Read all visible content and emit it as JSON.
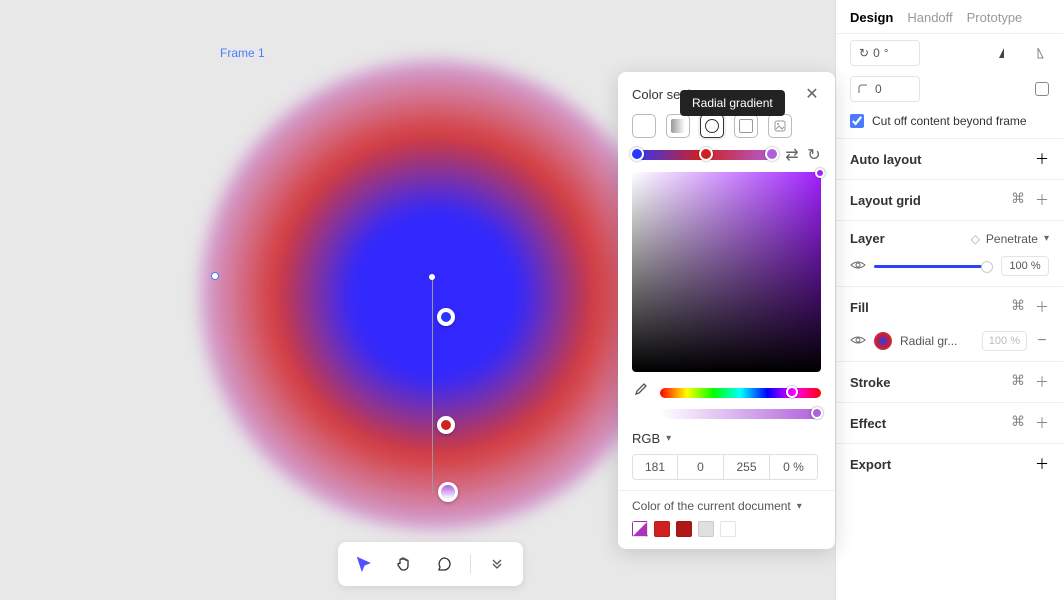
{
  "canvas": {
    "frame_label": "Frame 1"
  },
  "tooltip": "Radial gradient",
  "color_panel": {
    "title": "Color settings",
    "mode_label": "RGB",
    "rgba": {
      "r": "181",
      "g": "0",
      "b": "255",
      "a": "0"
    },
    "alpha_unit": "%",
    "doc_colors_label": "Color of the current document",
    "gradient_stops": [
      {
        "pos": 0,
        "color": "#2838ff"
      },
      {
        "pos": 48,
        "color": "#d02020"
      },
      {
        "pos": 100,
        "color": "#b060dd"
      }
    ],
    "swatches": [
      "#b030c0",
      "#d02020",
      "#b01818",
      "#e0e0e0",
      "#ffffff"
    ]
  },
  "right_panel": {
    "tabs": [
      "Design",
      "Handoff",
      "Prototype"
    ],
    "rotation_value": "0",
    "rotation_unit": "°",
    "corner_radius": "0",
    "cut_off_label": "Cut off content beyond frame",
    "cut_off_checked": true,
    "sections": {
      "auto_layout": "Auto layout",
      "layout_grid": "Layout grid",
      "layer": "Layer",
      "layer_blend": "Penetrate",
      "layer_opacity": "100",
      "layer_opacity_unit": "%",
      "fill": "Fill",
      "fill_item_label": "Radial gr...",
      "fill_item_opacity": "100",
      "fill_item_unit": "%",
      "stroke": "Stroke",
      "effect": "Effect",
      "export": "Export"
    }
  }
}
